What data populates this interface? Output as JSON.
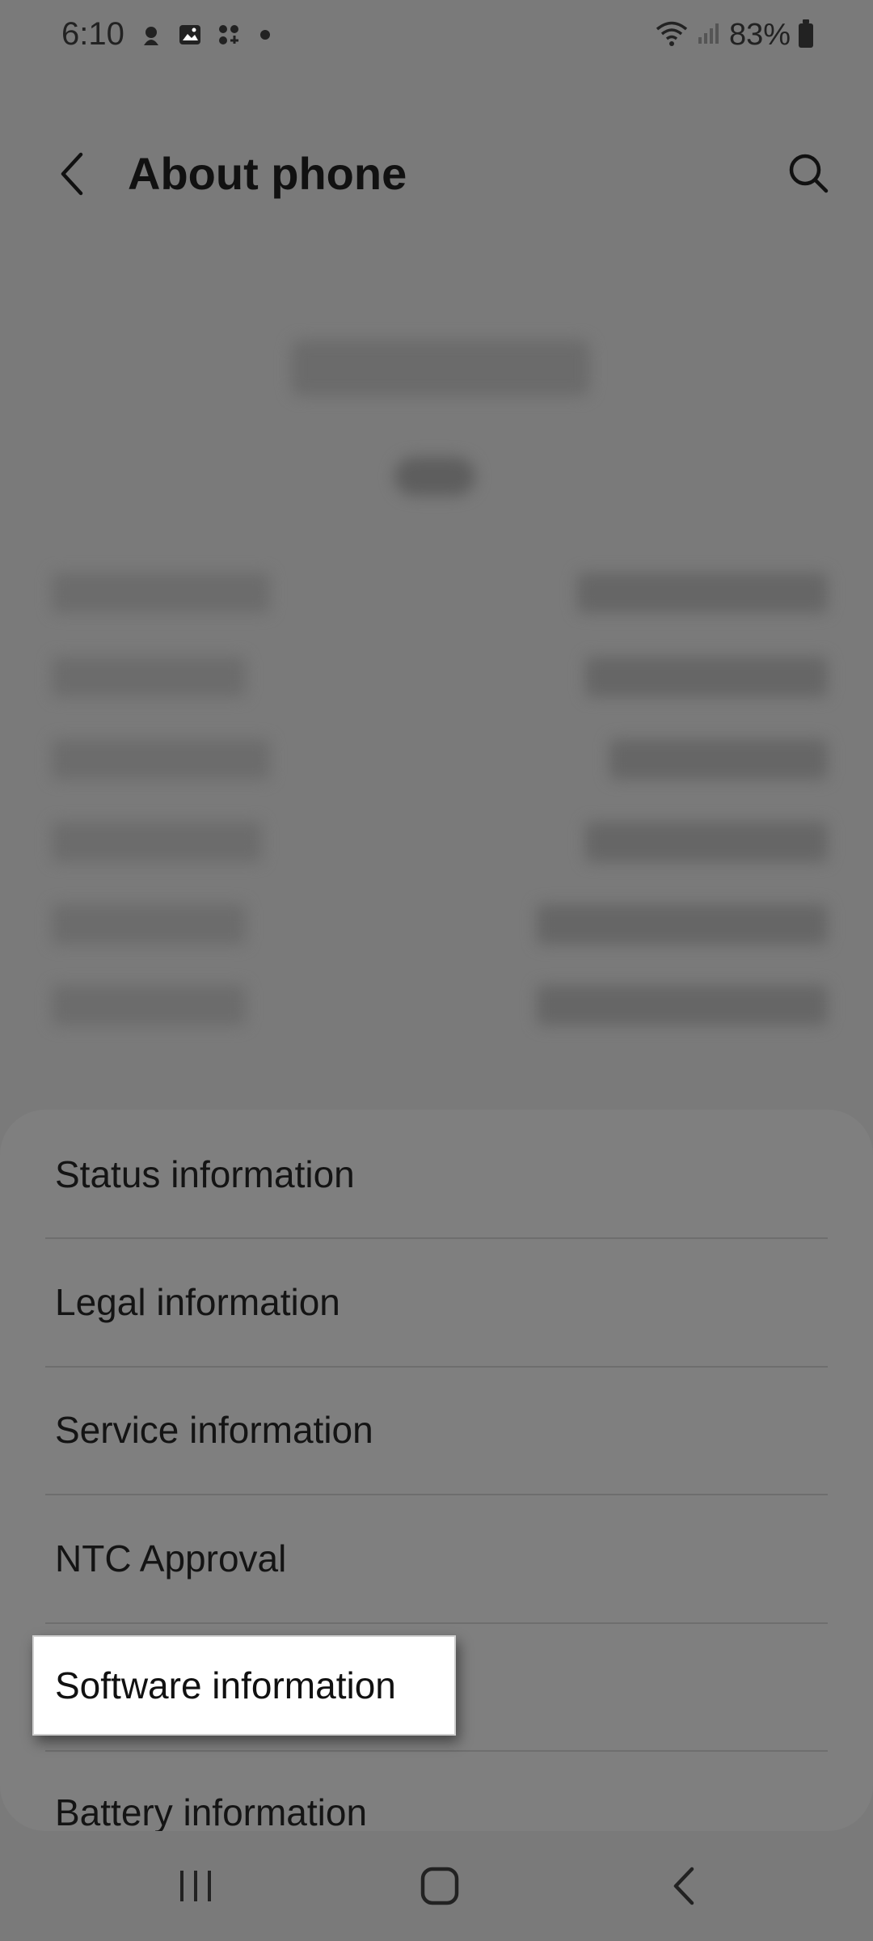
{
  "status_bar": {
    "time": "6:10",
    "battery": "83%",
    "icons": [
      "notification-app-icon",
      "gallery-icon",
      "apps-icon",
      "more-dot-icon",
      "wifi-icon",
      "signal-icon",
      "battery-icon"
    ]
  },
  "header": {
    "title": "About phone",
    "back_icon": "chevron-left-icon",
    "search_icon": "search-icon"
  },
  "menu": {
    "items": [
      {
        "label": "Status information"
      },
      {
        "label": "Legal information"
      },
      {
        "label": "Service information"
      },
      {
        "label": "NTC Approval"
      },
      {
        "label": "Software information"
      },
      {
        "label": "Battery information"
      }
    ],
    "highlighted": "Software information"
  },
  "nav_bar": {
    "icons": [
      "recents-icon",
      "home-icon",
      "back-icon"
    ]
  },
  "colors": {
    "background": "#7a7a7a",
    "card": "#7f7f7f",
    "highlight": "#ffffff",
    "text": "#111111"
  }
}
